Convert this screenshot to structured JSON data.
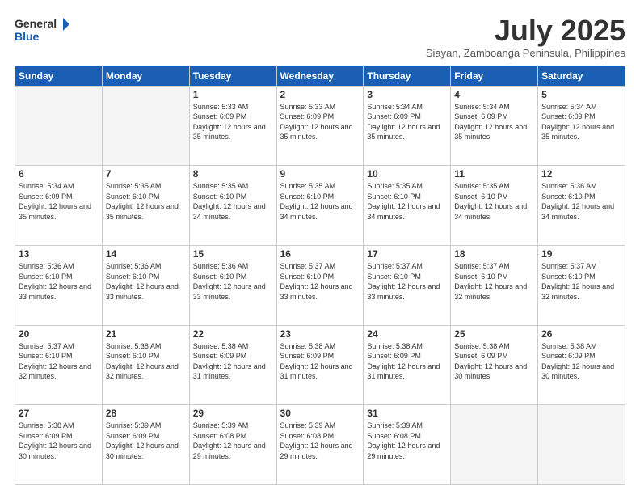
{
  "logo": {
    "general": "General",
    "blue": "Blue"
  },
  "title": "July 2025",
  "subtitle": "Siayan, Zamboanga Peninsula, Philippines",
  "headers": [
    "Sunday",
    "Monday",
    "Tuesday",
    "Wednesday",
    "Thursday",
    "Friday",
    "Saturday"
  ],
  "weeks": [
    [
      {
        "day": "",
        "sunrise": "",
        "sunset": "",
        "daylight": ""
      },
      {
        "day": "",
        "sunrise": "",
        "sunset": "",
        "daylight": ""
      },
      {
        "day": "1",
        "sunrise": "Sunrise: 5:33 AM",
        "sunset": "Sunset: 6:09 PM",
        "daylight": "Daylight: 12 hours and 35 minutes."
      },
      {
        "day": "2",
        "sunrise": "Sunrise: 5:33 AM",
        "sunset": "Sunset: 6:09 PM",
        "daylight": "Daylight: 12 hours and 35 minutes."
      },
      {
        "day": "3",
        "sunrise": "Sunrise: 5:34 AM",
        "sunset": "Sunset: 6:09 PM",
        "daylight": "Daylight: 12 hours and 35 minutes."
      },
      {
        "day": "4",
        "sunrise": "Sunrise: 5:34 AM",
        "sunset": "Sunset: 6:09 PM",
        "daylight": "Daylight: 12 hours and 35 minutes."
      },
      {
        "day": "5",
        "sunrise": "Sunrise: 5:34 AM",
        "sunset": "Sunset: 6:09 PM",
        "daylight": "Daylight: 12 hours and 35 minutes."
      }
    ],
    [
      {
        "day": "6",
        "sunrise": "Sunrise: 5:34 AM",
        "sunset": "Sunset: 6:09 PM",
        "daylight": "Daylight: 12 hours and 35 minutes."
      },
      {
        "day": "7",
        "sunrise": "Sunrise: 5:35 AM",
        "sunset": "Sunset: 6:10 PM",
        "daylight": "Daylight: 12 hours and 35 minutes."
      },
      {
        "day": "8",
        "sunrise": "Sunrise: 5:35 AM",
        "sunset": "Sunset: 6:10 PM",
        "daylight": "Daylight: 12 hours and 34 minutes."
      },
      {
        "day": "9",
        "sunrise": "Sunrise: 5:35 AM",
        "sunset": "Sunset: 6:10 PM",
        "daylight": "Daylight: 12 hours and 34 minutes."
      },
      {
        "day": "10",
        "sunrise": "Sunrise: 5:35 AM",
        "sunset": "Sunset: 6:10 PM",
        "daylight": "Daylight: 12 hours and 34 minutes."
      },
      {
        "day": "11",
        "sunrise": "Sunrise: 5:35 AM",
        "sunset": "Sunset: 6:10 PM",
        "daylight": "Daylight: 12 hours and 34 minutes."
      },
      {
        "day": "12",
        "sunrise": "Sunrise: 5:36 AM",
        "sunset": "Sunset: 6:10 PM",
        "daylight": "Daylight: 12 hours and 34 minutes."
      }
    ],
    [
      {
        "day": "13",
        "sunrise": "Sunrise: 5:36 AM",
        "sunset": "Sunset: 6:10 PM",
        "daylight": "Daylight: 12 hours and 33 minutes."
      },
      {
        "day": "14",
        "sunrise": "Sunrise: 5:36 AM",
        "sunset": "Sunset: 6:10 PM",
        "daylight": "Daylight: 12 hours and 33 minutes."
      },
      {
        "day": "15",
        "sunrise": "Sunrise: 5:36 AM",
        "sunset": "Sunset: 6:10 PM",
        "daylight": "Daylight: 12 hours and 33 minutes."
      },
      {
        "day": "16",
        "sunrise": "Sunrise: 5:37 AM",
        "sunset": "Sunset: 6:10 PM",
        "daylight": "Daylight: 12 hours and 33 minutes."
      },
      {
        "day": "17",
        "sunrise": "Sunrise: 5:37 AM",
        "sunset": "Sunset: 6:10 PM",
        "daylight": "Daylight: 12 hours and 33 minutes."
      },
      {
        "day": "18",
        "sunrise": "Sunrise: 5:37 AM",
        "sunset": "Sunset: 6:10 PM",
        "daylight": "Daylight: 12 hours and 32 minutes."
      },
      {
        "day": "19",
        "sunrise": "Sunrise: 5:37 AM",
        "sunset": "Sunset: 6:10 PM",
        "daylight": "Daylight: 12 hours and 32 minutes."
      }
    ],
    [
      {
        "day": "20",
        "sunrise": "Sunrise: 5:37 AM",
        "sunset": "Sunset: 6:10 PM",
        "daylight": "Daylight: 12 hours and 32 minutes."
      },
      {
        "day": "21",
        "sunrise": "Sunrise: 5:38 AM",
        "sunset": "Sunset: 6:10 PM",
        "daylight": "Daylight: 12 hours and 32 minutes."
      },
      {
        "day": "22",
        "sunrise": "Sunrise: 5:38 AM",
        "sunset": "Sunset: 6:09 PM",
        "daylight": "Daylight: 12 hours and 31 minutes."
      },
      {
        "day": "23",
        "sunrise": "Sunrise: 5:38 AM",
        "sunset": "Sunset: 6:09 PM",
        "daylight": "Daylight: 12 hours and 31 minutes."
      },
      {
        "day": "24",
        "sunrise": "Sunrise: 5:38 AM",
        "sunset": "Sunset: 6:09 PM",
        "daylight": "Daylight: 12 hours and 31 minutes."
      },
      {
        "day": "25",
        "sunrise": "Sunrise: 5:38 AM",
        "sunset": "Sunset: 6:09 PM",
        "daylight": "Daylight: 12 hours and 30 minutes."
      },
      {
        "day": "26",
        "sunrise": "Sunrise: 5:38 AM",
        "sunset": "Sunset: 6:09 PM",
        "daylight": "Daylight: 12 hours and 30 minutes."
      }
    ],
    [
      {
        "day": "27",
        "sunrise": "Sunrise: 5:38 AM",
        "sunset": "Sunset: 6:09 PM",
        "daylight": "Daylight: 12 hours and 30 minutes."
      },
      {
        "day": "28",
        "sunrise": "Sunrise: 5:39 AM",
        "sunset": "Sunset: 6:09 PM",
        "daylight": "Daylight: 12 hours and 30 minutes."
      },
      {
        "day": "29",
        "sunrise": "Sunrise: 5:39 AM",
        "sunset": "Sunset: 6:08 PM",
        "daylight": "Daylight: 12 hours and 29 minutes."
      },
      {
        "day": "30",
        "sunrise": "Sunrise: 5:39 AM",
        "sunset": "Sunset: 6:08 PM",
        "daylight": "Daylight: 12 hours and 29 minutes."
      },
      {
        "day": "31",
        "sunrise": "Sunrise: 5:39 AM",
        "sunset": "Sunset: 6:08 PM",
        "daylight": "Daylight: 12 hours and 29 minutes."
      },
      {
        "day": "",
        "sunrise": "",
        "sunset": "",
        "daylight": ""
      },
      {
        "day": "",
        "sunrise": "",
        "sunset": "",
        "daylight": ""
      }
    ]
  ]
}
